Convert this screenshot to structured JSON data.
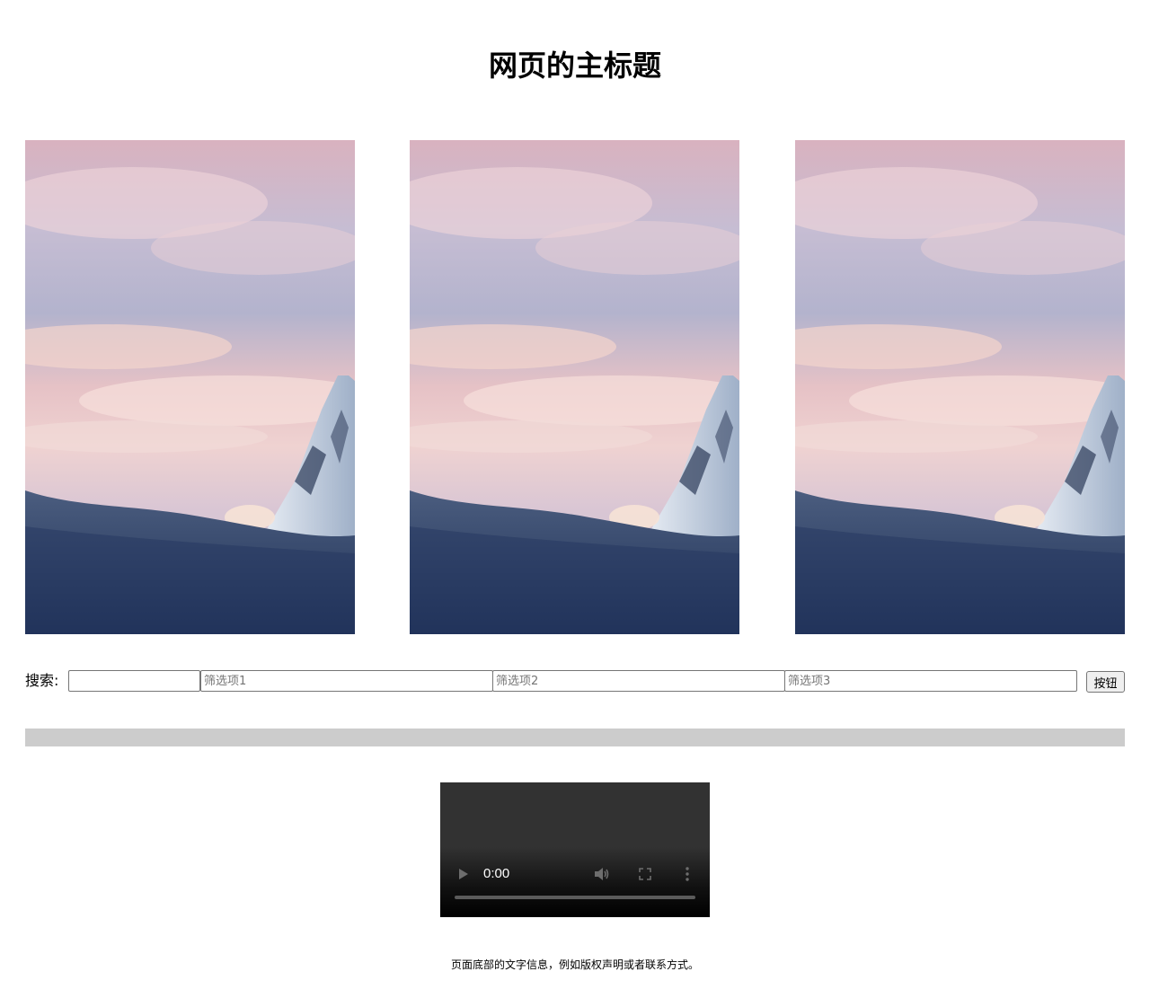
{
  "header": {
    "title": "网页的主标题"
  },
  "gallery": {
    "images": [
      {
        "subject": "snowy mountain peak under pink sunset clouds"
      },
      {
        "subject": "snowy mountain peak under pink sunset clouds"
      },
      {
        "subject": "snowy mountain peak under pink sunset clouds"
      }
    ]
  },
  "search": {
    "label": "搜索:",
    "value": "",
    "placeholder": "",
    "filters": [
      {
        "value": "",
        "placeholder": "筛选项1"
      },
      {
        "value": "",
        "placeholder": "筛选项2"
      },
      {
        "value": "",
        "placeholder": "筛选项3"
      }
    ],
    "button_label": "按钮"
  },
  "divider": {
    "color": "#cccccc"
  },
  "video": {
    "time": "0:00",
    "progress": 0,
    "icons": [
      "play-icon",
      "volume-icon",
      "fullscreen-icon",
      "more-options-icon"
    ]
  },
  "footer": {
    "text": "页面底部的文字信息，例如版权声明或者联系方式。"
  }
}
